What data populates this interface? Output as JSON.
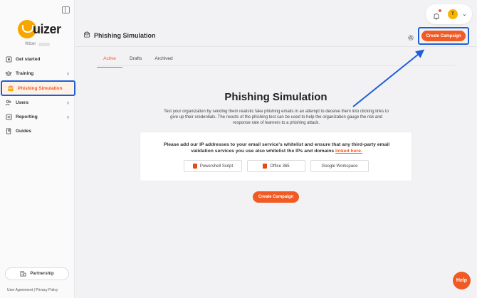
{
  "brand": {
    "logo_text": "uizer",
    "org_label": "Wizer"
  },
  "sidebar": {
    "items": [
      {
        "label": "Get started",
        "icon": "get-started-icon",
        "active": false,
        "has_chevron": false
      },
      {
        "label": "Training",
        "icon": "training-icon",
        "active": false,
        "has_chevron": true
      },
      {
        "label": "Phishing Simulation",
        "icon": "phishing-icon",
        "active": true,
        "has_chevron": false
      },
      {
        "label": "Users",
        "icon": "users-icon",
        "active": false,
        "has_chevron": true
      },
      {
        "label": "Reporting",
        "icon": "reporting-icon",
        "active": false,
        "has_chevron": true
      },
      {
        "label": "Guides",
        "icon": "guides-icon",
        "active": false,
        "has_chevron": false
      }
    ],
    "partnership_label": "Partnership",
    "footer_links": "User Agreement | Privacy Policy"
  },
  "header": {
    "title": "Phishing Simulation",
    "create_label": "Create Campaign",
    "avatar_initial": "T"
  },
  "tabs": [
    {
      "label": "Active",
      "active": true
    },
    {
      "label": "Drafts",
      "active": false
    },
    {
      "label": "Archived",
      "active": false
    }
  ],
  "main": {
    "title": "Phishing Simulation",
    "description": "Test your organization by sending them realistic fake phishing emails in an attempt to deceive them into clicking links to give up their credentials. The results of the phishing test can be used to help the organization gauge the risk and response rate of learners to a phishing attack.",
    "card_text": "Please add our IP addresses to your email service's whitelist and ensure that any third-party email validation services you use also whitelist the IPs and domains",
    "card_link": "linked here.",
    "buttons": [
      "Powershell Script",
      "Office 365",
      "Google Workspace"
    ],
    "create_label": "Create Campaign"
  },
  "help_label": "Help",
  "colors": {
    "accent": "#f15a22",
    "highlight": "#1f5fd6",
    "brand_yellow": "#f7a600"
  }
}
